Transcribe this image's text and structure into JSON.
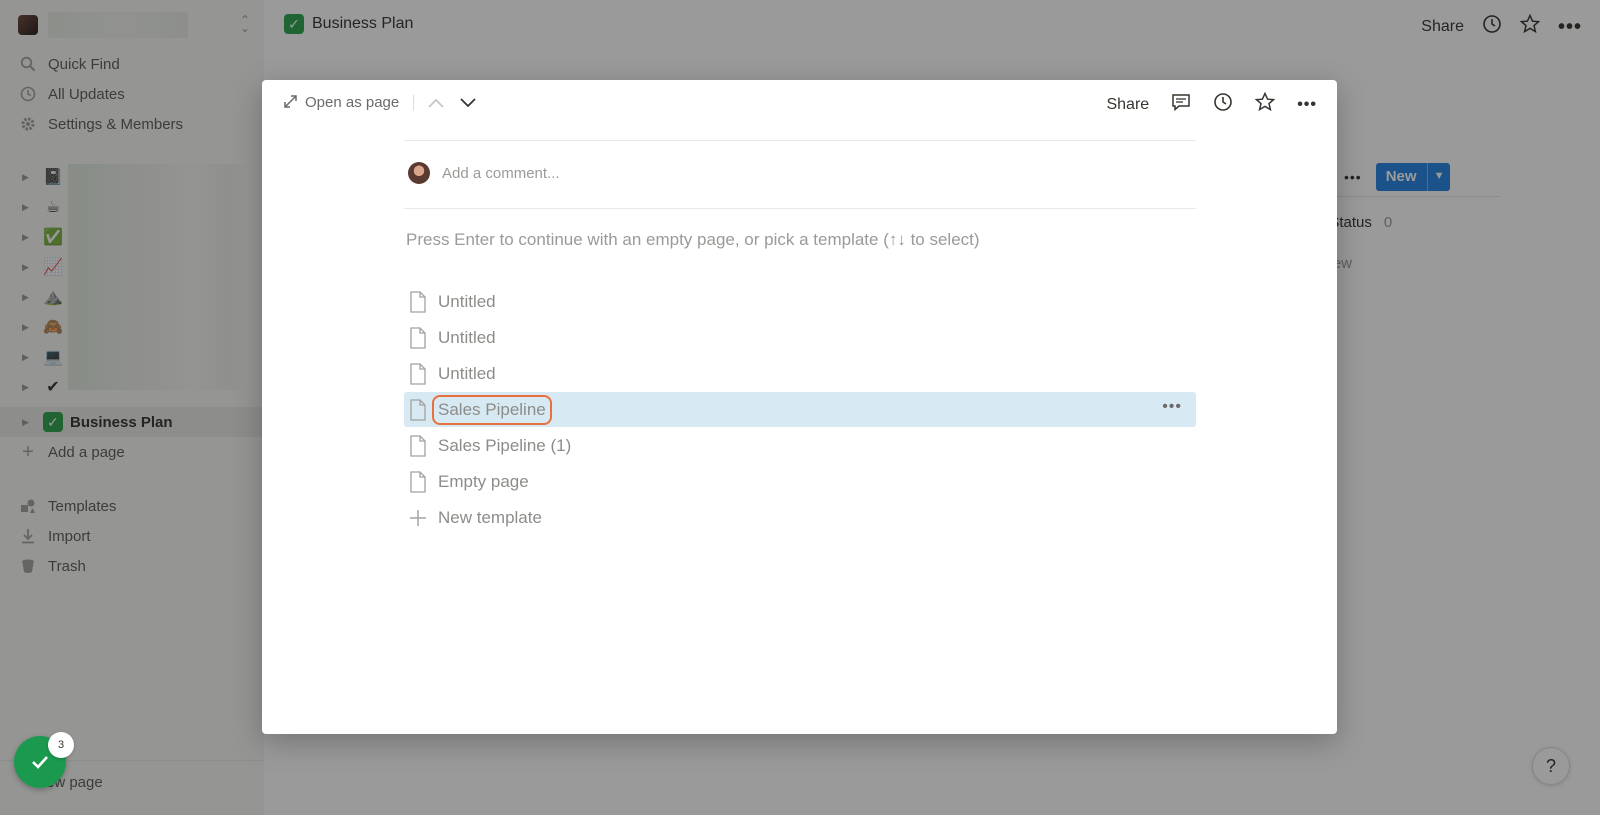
{
  "sidebar": {
    "nav": [
      {
        "label": "Quick Find",
        "icon": "search-icon"
      },
      {
        "label": "All Updates",
        "icon": "clock-icon"
      },
      {
        "label": "Settings & Members",
        "icon": "gear-icon"
      }
    ],
    "tree": [
      {
        "emoji": "📓",
        "label": ""
      },
      {
        "emoji": "☕",
        "label": ""
      },
      {
        "emoji": "✅",
        "label": ""
      },
      {
        "emoji": "📈",
        "label": ""
      },
      {
        "emoji": "⛰️",
        "label": ""
      },
      {
        "emoji": "🙈",
        "label": ""
      },
      {
        "emoji": "💻",
        "label": ""
      },
      {
        "emoji": "✔",
        "label": ""
      }
    ],
    "active_page": "Business Plan",
    "add_page": "Add a page",
    "bottom": [
      {
        "label": "Templates",
        "icon": "templates-icon"
      },
      {
        "label": "Import",
        "icon": "import-icon"
      },
      {
        "label": "Trash",
        "icon": "trash-icon"
      }
    ],
    "new_page": "ew page",
    "badge_count": "3"
  },
  "header": {
    "title": "Business Plan",
    "share": "Share"
  },
  "board": {
    "new_button": "New",
    "status_label": "No Status",
    "status_count": "0",
    "new_row": "New"
  },
  "modal": {
    "open_as_page": "Open as page",
    "share": "Share",
    "comment_placeholder": "Add a comment...",
    "hint": "Press Enter to continue with an empty page, or pick a template (↑↓ to select)",
    "templates": [
      {
        "label": "Untitled"
      },
      {
        "label": "Untitled"
      },
      {
        "label": "Untitled"
      },
      {
        "label": "Sales Pipeline"
      },
      {
        "label": "Sales Pipeline (1)"
      },
      {
        "label": "Empty page"
      }
    ],
    "new_template": "New template"
  },
  "help_label": "?"
}
